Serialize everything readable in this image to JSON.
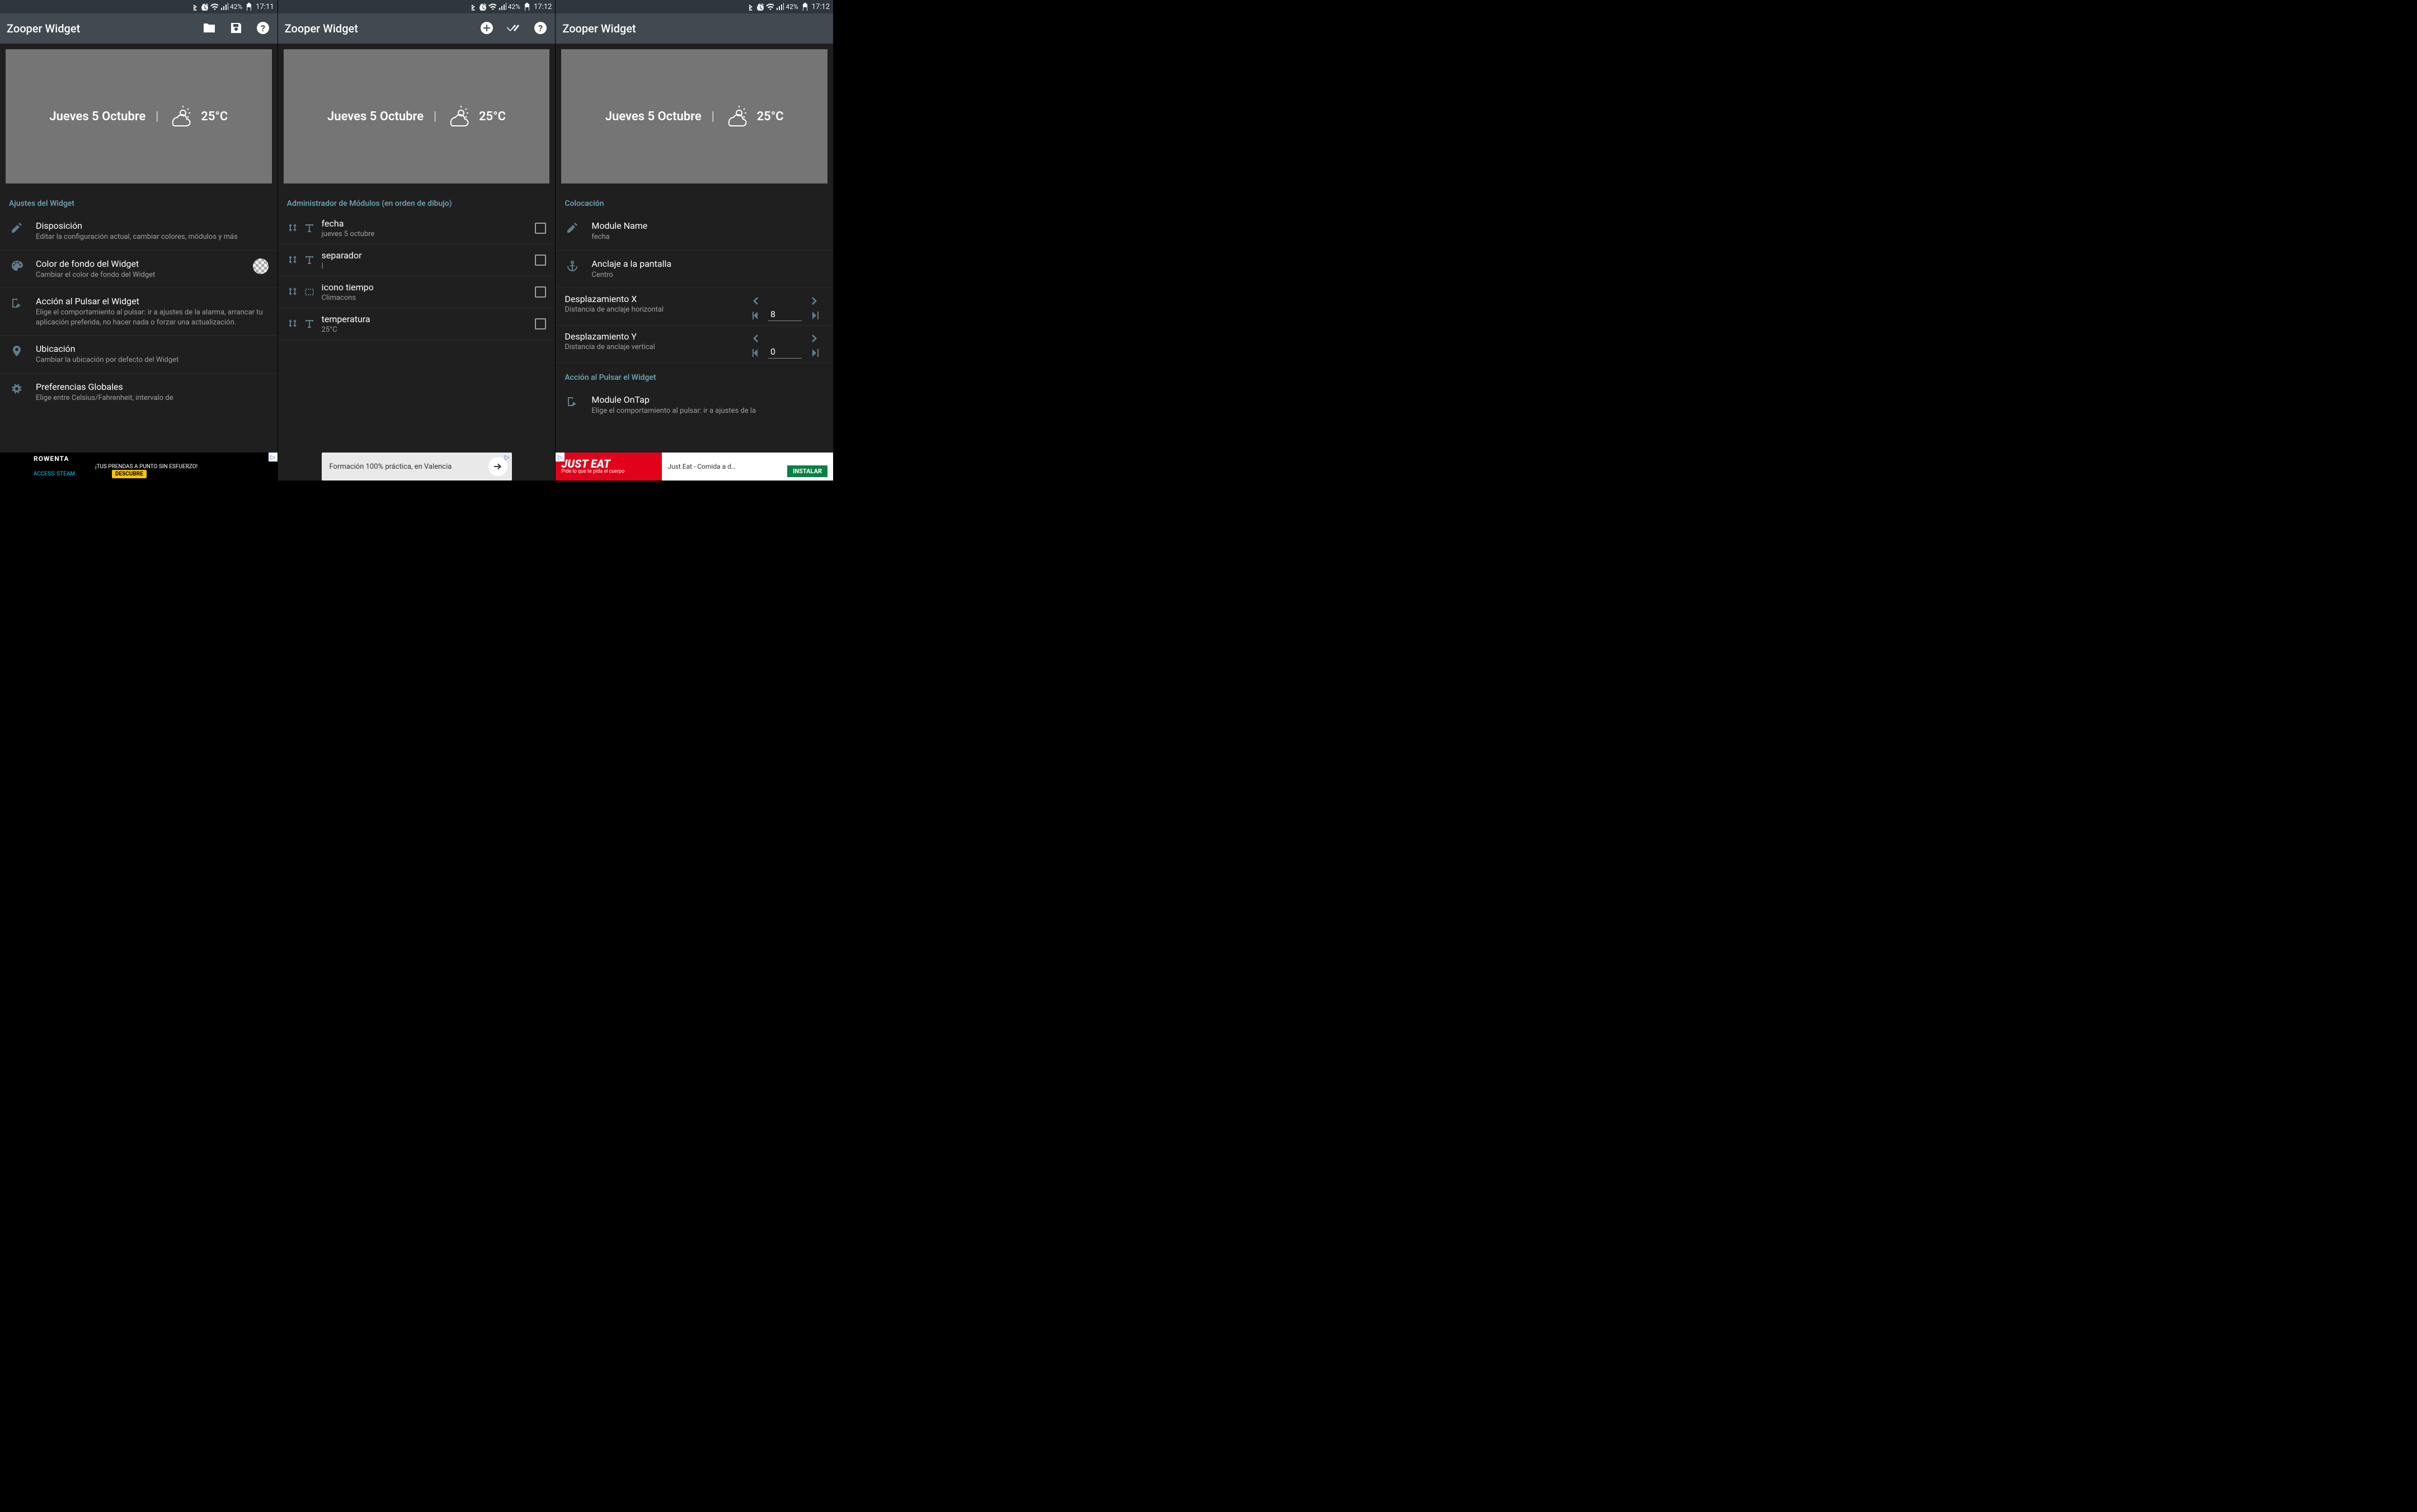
{
  "status": {
    "battery_pct": "42%",
    "time_a": "17:11",
    "time_b": "17:12",
    "time_c": "17:12"
  },
  "appbar": {
    "title": "Zooper Widget"
  },
  "preview": {
    "date": "Jueves 5 Octubre",
    "separator": "|",
    "temp": "25°C"
  },
  "screen1": {
    "section": "Ajustes del Widget",
    "rows": [
      {
        "title": "Disposición",
        "sub": "Editar la configuración actual, cambiar colores, módulos y más"
      },
      {
        "title": "Color de fondo del Widget",
        "sub": "Cambiar el color de fondo del Widget"
      },
      {
        "title": "Acción al Pulsar el Widget",
        "sub": "Elige el comportamiento al pulsar: ir a ajustes de la alarma, arrancar tu aplicación preferida, no hacer nada o forzar una actualización."
      },
      {
        "title": "Ubicación",
        "sub": "Cambiar la ubicación por defecto del Widget"
      },
      {
        "title": "Preferencias Globales",
        "sub": "Elige entre Celsius/Fahrenheit, intervalo de"
      }
    ]
  },
  "screen2": {
    "section": "Administrador de Módulos (en orden de dibujo)",
    "modules": [
      {
        "title": "fecha",
        "sub": "jueves 5 octubre"
      },
      {
        "title": "separador",
        "sub": "|"
      },
      {
        "title": "icono tiempo",
        "sub": "Climacons"
      },
      {
        "title": "temperatura",
        "sub": "25°C"
      }
    ]
  },
  "screen3": {
    "section1": "Colocación",
    "name_row": {
      "title": "Module Name",
      "sub": "fecha"
    },
    "anchor_row": {
      "title": "Anclaje a la pantalla",
      "sub": "Centro"
    },
    "offx": {
      "title": "Desplazamiento X",
      "sub": "Distancia de anclaje horizontal",
      "value": "8"
    },
    "offy": {
      "title": "Desplazamiento Y",
      "sub": "Distancia de anclaje vertical",
      "value": "0"
    },
    "section2": "Acción al Pulsar el Widget",
    "ontap": {
      "title": "Module OnTap",
      "sub": "Elige el comportamiento al pulsar: ir a ajustes de la"
    }
  },
  "ads": {
    "rowenta": {
      "brand": "ROWENTA",
      "tag": "ACCESS' STEAM",
      "slogan": "¡TUS PRENDAS A PUNTO SIN ESFUERZO!",
      "cta": "DESCUBRE"
    },
    "formacion": {
      "text": "Formación 100% práctica, en Valencia"
    },
    "justeat": {
      "brand1": "JUST",
      "brand2": "EAT",
      "slogan": "Pide lo que te pida el cuerpo",
      "title": "Just Eat - Comida a d…",
      "cta": "INSTALAR"
    }
  }
}
